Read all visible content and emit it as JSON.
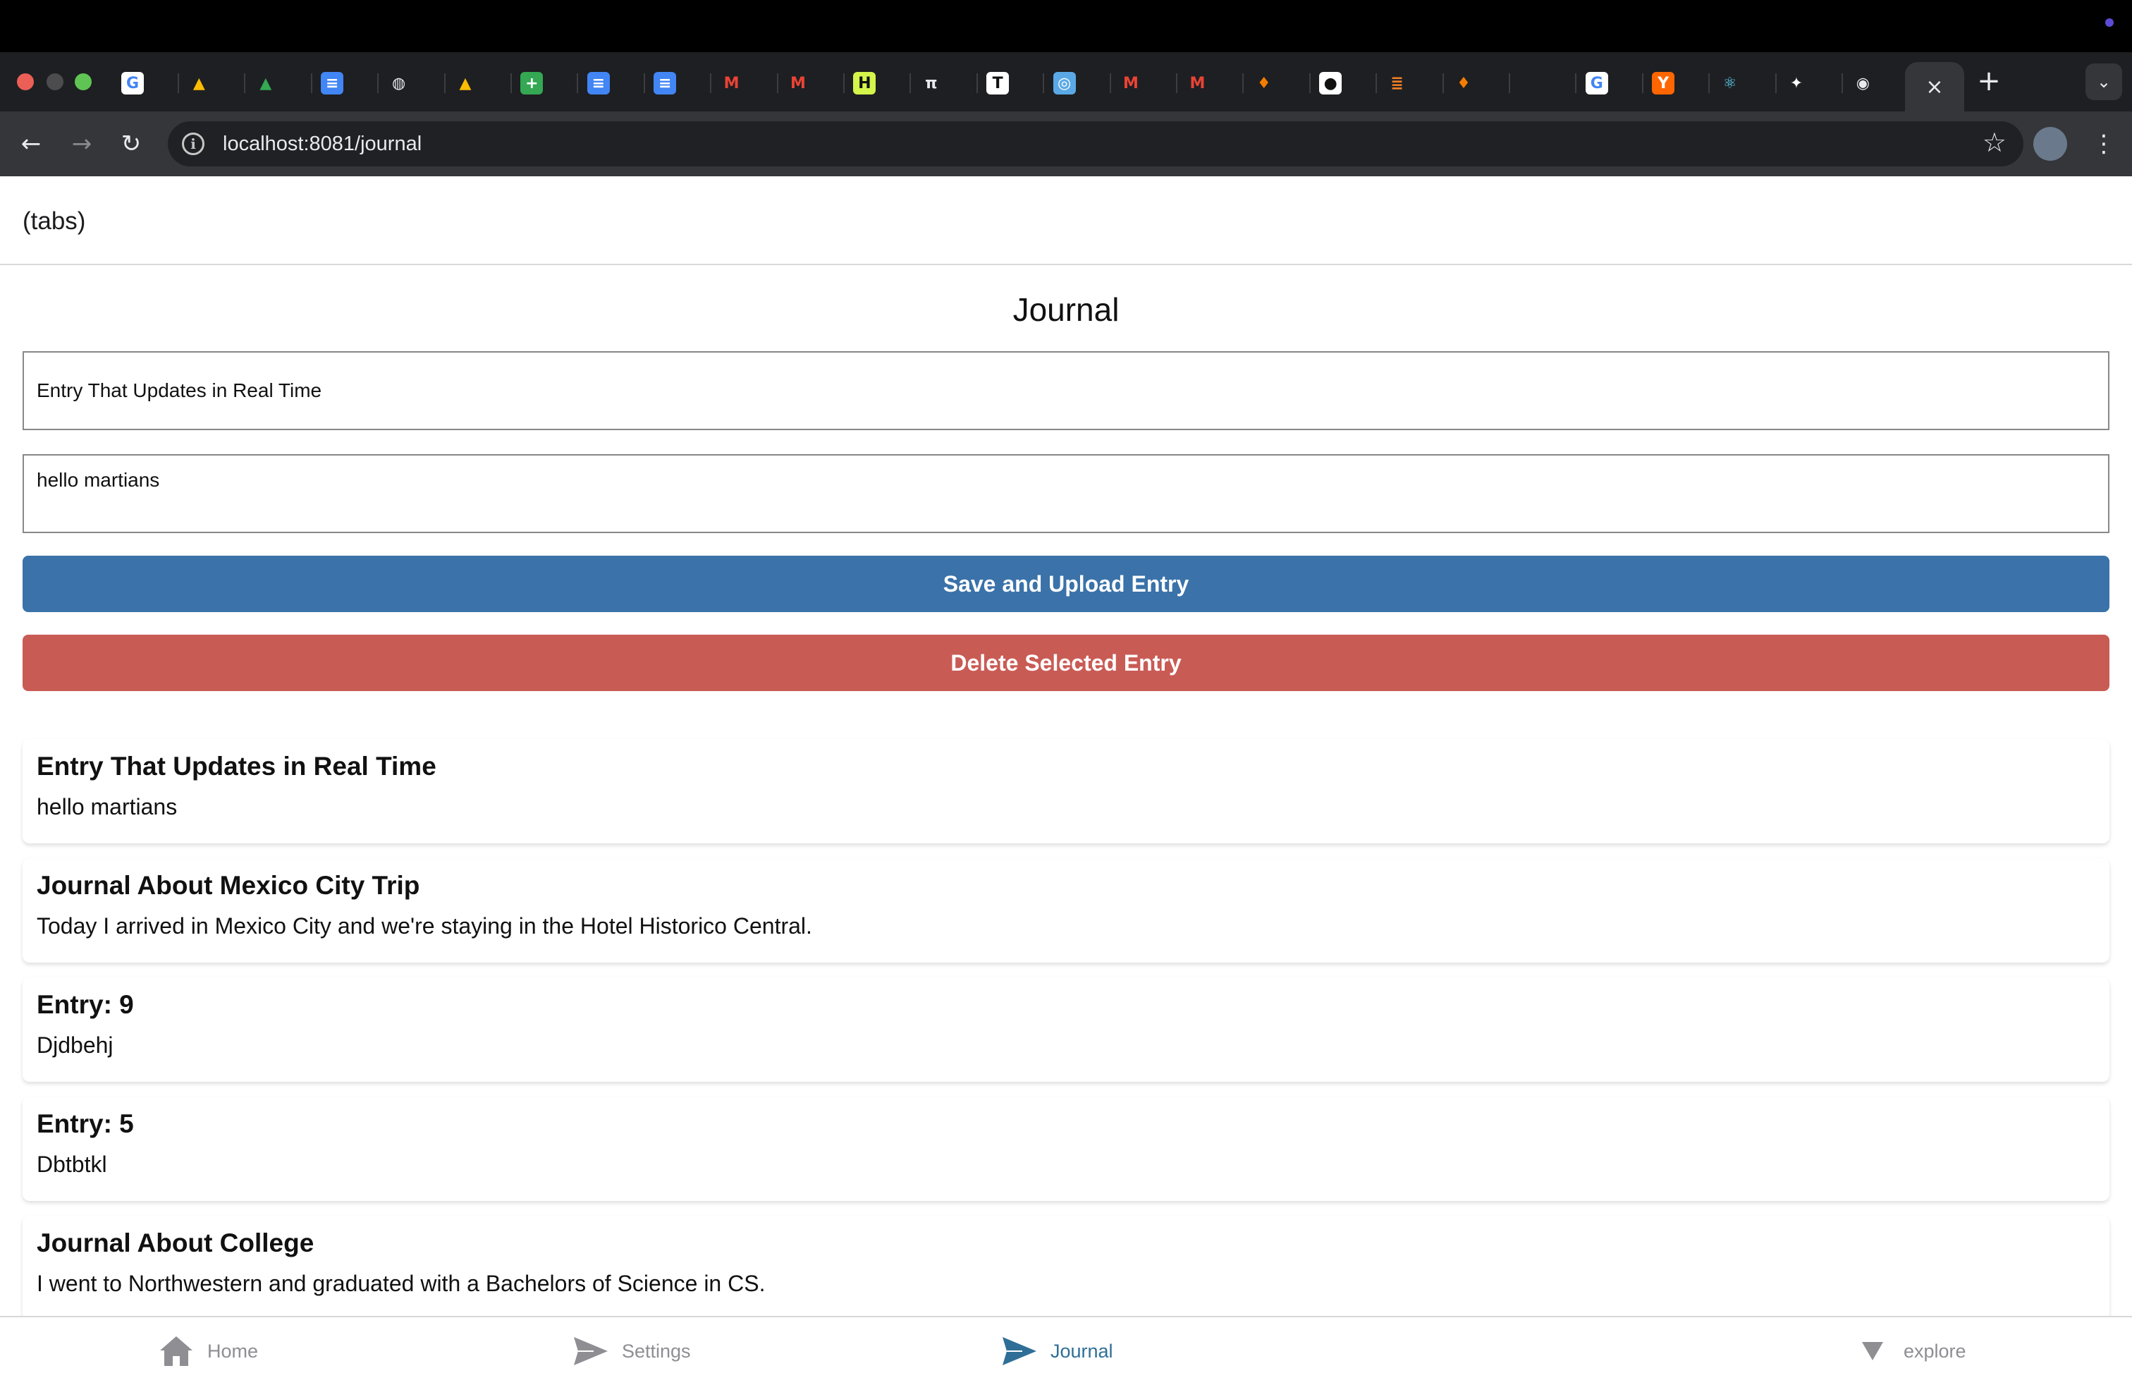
{
  "browser": {
    "url": "localhost:8081/journal",
    "tab_favicons": [
      {
        "icon": "google-icon",
        "color": "#ffffff",
        "glyph": "G",
        "fg": "#4285f4"
      },
      {
        "icon": "drive-icon",
        "color": "#1e1f22",
        "glyph": "▲",
        "fg": "#fbbc04"
      },
      {
        "icon": "drive-icon",
        "color": "#1e1f22",
        "glyph": "▲",
        "fg": "#34a853"
      },
      {
        "icon": "docs-icon",
        "color": "#4285f4",
        "glyph": "≡",
        "fg": "#ffffff"
      },
      {
        "icon": "globe-icon",
        "color": "#1e1f22",
        "glyph": "◍",
        "fg": "#e8eaed"
      },
      {
        "icon": "drive-icon",
        "color": "#1e1f22",
        "glyph": "▲",
        "fg": "#fbbc04"
      },
      {
        "icon": "sheets-icon",
        "color": "#34a853",
        "glyph": "+",
        "fg": "#ffffff"
      },
      {
        "icon": "docs-icon",
        "color": "#4285f4",
        "glyph": "≡",
        "fg": "#ffffff"
      },
      {
        "icon": "docs-icon",
        "color": "#4285f4",
        "glyph": "≡",
        "fg": "#ffffff"
      },
      {
        "icon": "gmail-icon",
        "color": "#1e1f22",
        "glyph": "M",
        "fg": "#ea4335"
      },
      {
        "icon": "gmail-icon",
        "color": "#1e1f22",
        "glyph": "M",
        "fg": "#ea4335"
      },
      {
        "icon": "h-icon",
        "color": "#d4f54a",
        "glyph": "H",
        "fg": "#111111"
      },
      {
        "icon": "pi-icon",
        "color": "#1e1f22",
        "glyph": "π",
        "fg": "#e8eaed"
      },
      {
        "icon": "t-icon",
        "color": "#ffffff",
        "glyph": "T",
        "fg": "#111111"
      },
      {
        "icon": "circle-icon",
        "color": "#5aa9e6",
        "glyph": "◎",
        "fg": "#ffffff"
      },
      {
        "icon": "gmail-icon",
        "color": "#1e1f22",
        "glyph": "M",
        "fg": "#ea4335"
      },
      {
        "icon": "gmail-icon",
        "color": "#1e1f22",
        "glyph": "M",
        "fg": "#ea4335"
      },
      {
        "icon": "fire-icon",
        "color": "#1e1f22",
        "glyph": "♦",
        "fg": "#f57c00"
      },
      {
        "icon": "github-icon",
        "color": "#ffffff",
        "glyph": "●",
        "fg": "#111111"
      },
      {
        "icon": "stack-icon",
        "color": "#1e1f22",
        "glyph": "≣",
        "fg": "#f48024"
      },
      {
        "icon": "fire-icon",
        "color": "#1e1f22",
        "glyph": "♦",
        "fg": "#f57c00"
      },
      {
        "icon": "blank-icon",
        "color": "#1e1f22",
        "glyph": "",
        "fg": "#1a2a5a"
      },
      {
        "icon": "google-icon",
        "color": "#ffffff",
        "glyph": "G",
        "fg": "#4285f4"
      },
      {
        "icon": "ycombinator-icon",
        "color": "#ff6600",
        "glyph": "Y",
        "fg": "#ffffff"
      },
      {
        "icon": "react-icon",
        "color": "#1e1f22",
        "glyph": "⚛",
        "fg": "#61dafb"
      },
      {
        "icon": "figma-icon",
        "color": "#1e1f22",
        "glyph": "✦",
        "fg": "#ffffff"
      },
      {
        "icon": "chrome-icon",
        "color": "#1e1f22",
        "glyph": "◉",
        "fg": "#e8eaed"
      }
    ]
  },
  "app": {
    "header_title": "(tabs)",
    "page_title": "Journal",
    "title_input_value": "Entry That Updates in Real Time",
    "body_input_value": "hello martians",
    "save_label": "Save and Upload Entry",
    "delete_label": "Delete Selected Entry",
    "entries": [
      {
        "title": "Entry That Updates in Real Time",
        "body": "hello martians"
      },
      {
        "title": "Journal About Mexico City Trip",
        "body": "Today I arrived in Mexico City and we're staying in the Hotel Historico Central."
      },
      {
        "title": "Entry: 9",
        "body": "Djdbehj"
      },
      {
        "title": "Entry: 5",
        "body": "Dbtbtkl"
      },
      {
        "title": "Journal About College",
        "body": "I went to Northwestern and graduated with a Bachelors of Science in CS."
      }
    ],
    "tabs": [
      {
        "label": "Home",
        "icon": "home-icon",
        "active": false
      },
      {
        "label": "Settings",
        "icon": "send-icon",
        "active": false
      },
      {
        "label": "Journal",
        "icon": "send-icon",
        "active": true
      },
      {
        "label": "explore",
        "icon": "triangle-down-icon",
        "active": false
      }
    ],
    "colors": {
      "save": "#3a72a9",
      "delete": "#c95b55",
      "active_tab": "#2f6f97",
      "inactive_tab": "#8e8e93"
    }
  }
}
